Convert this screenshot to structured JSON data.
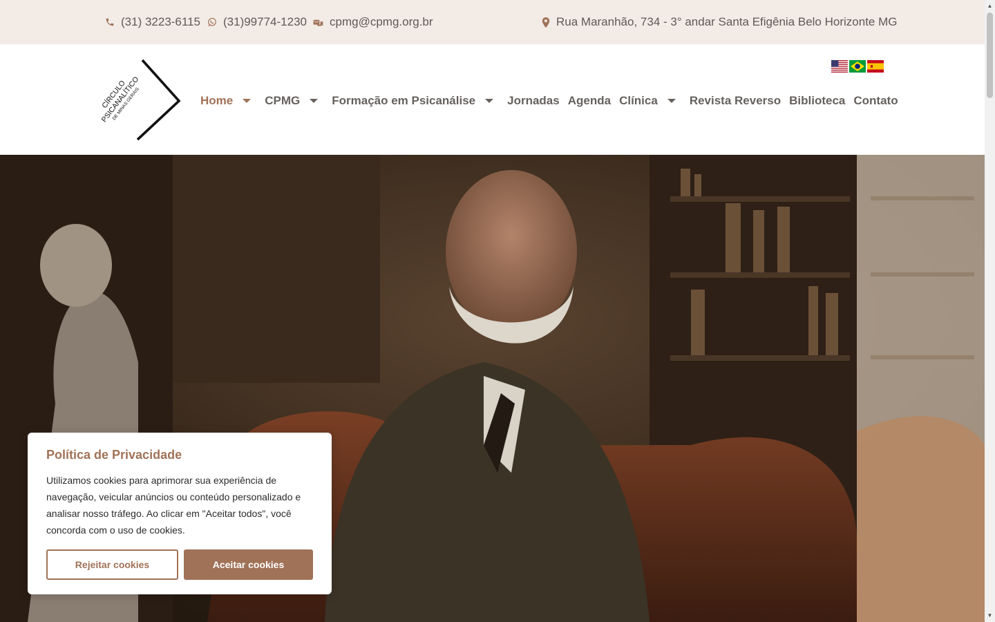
{
  "topbar": {
    "phone": "(31) 3223-6115",
    "whatsapp": "(31)99774-1230",
    "email": "cpmg@cpmg.org.br",
    "address": "Rua Maranhão, 734 - 3° andar Santa Efigênia Belo Horizonte MG",
    "icons": [
      "phone-icon",
      "whatsapp-icon",
      "mail-icon",
      "map-pin-icon"
    ]
  },
  "logo": {
    "line1": "CÍRCULO",
    "line2": "PSICANALÍTICO",
    "line3": "DE MINAS GERAIS"
  },
  "nav": {
    "items": [
      {
        "label": "Home",
        "dropdown": true,
        "active": true
      },
      {
        "label": "CPMG",
        "dropdown": true
      },
      {
        "label": "Formação em Psicanálise",
        "dropdown": true
      },
      {
        "label": "Jornadas",
        "dropdown": false
      },
      {
        "label": "Agenda",
        "dropdown": false
      },
      {
        "label": "Clínica",
        "dropdown": true
      },
      {
        "label": "Revista Reverso",
        "dropdown": false
      },
      {
        "label": "Biblioteca",
        "dropdown": false
      },
      {
        "label": "Contato",
        "dropdown": false
      }
    ]
  },
  "languages": [
    "flag-us-icon",
    "flag-br-icon",
    "flag-es-icon"
  ],
  "cookie": {
    "title": "Política de Privacidade",
    "text": "Utilizamos cookies para aprimorar sua experiência de navegação, veicular anúncios ou conteúdo personalizado e analisar nosso tráfego. Ao clicar em \"Aceitar todos\", você concorda com o uso de cookies.",
    "reject_label": "Rejeitar cookies",
    "accept_label": "Aceitar cookies"
  },
  "colors": {
    "accent": "#a07257",
    "topbar_bg": "#f3ebe6",
    "text": "#54595f"
  }
}
